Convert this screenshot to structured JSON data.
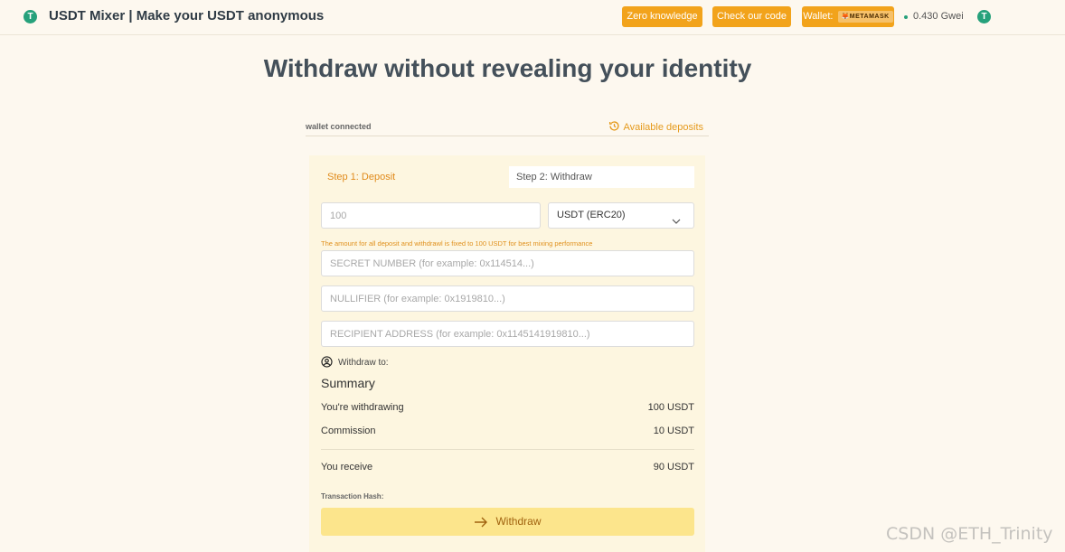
{
  "header": {
    "brand_icon": "T",
    "title": "USDT Mixer | Make your USDT anonymous",
    "nav": {
      "zero_knowledge": "Zero knowledge",
      "check_code": "Check our code",
      "wallet_label": "Wallet:",
      "wallet_badge": "METAMASK"
    },
    "gas": "0.430 Gwei",
    "token_icon": "T"
  },
  "main": {
    "title": "Withdraw without revealing your identity",
    "wallet_status": "wallet connected",
    "available_deposits": "Available deposits",
    "steps": [
      "Step 1: Deposit",
      "Step 2: Withdraw"
    ],
    "amount_placeholder": "100",
    "token_select": "USDT (ERC20)",
    "hint": "The amount for all deposit and withdrawl is fixed to 100 USDT for best mixing performance",
    "secret_placeholder": "SECRET NUMBER (for example: 0x114514...)",
    "nullifier_placeholder": "NULLIFIER (for example: 0x1919810...)",
    "recipient_placeholder": "RECIPIENT ADDRESS (for example: 0x1145141919810...)",
    "withdraw_to": "Withdraw to:",
    "summary": {
      "heading": "Summary",
      "withdrawing_label": "You're withdrawing",
      "withdrawing_value": "100 USDT",
      "commission_label": "Commission",
      "commission_value": "10 USDT",
      "receive_label": "You receive",
      "receive_value": "90 USDT"
    },
    "tx_hash_label": "Transaction Hash:",
    "withdraw_button": "Withdraw"
  },
  "watermark": "CSDN @ETH_Trinity",
  "colors": {
    "accent": "#f2a31b",
    "tether_green": "#26a17b",
    "button_yellow": "#fce58c",
    "background": "#fdf8ef"
  }
}
